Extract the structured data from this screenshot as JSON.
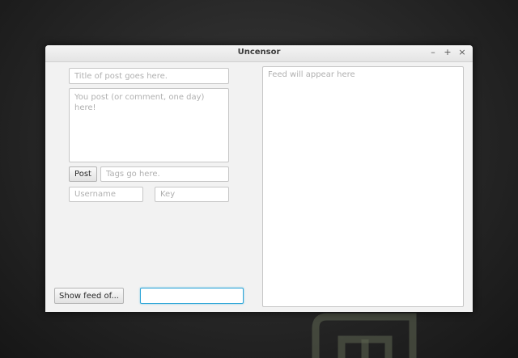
{
  "window": {
    "title": "Uncensor",
    "controls": {
      "minimize": "–",
      "maximize": "+",
      "close": "×"
    }
  },
  "form": {
    "title_placeholder": "Title of post goes here.",
    "title_value": "",
    "body_placeholder": "You post (or comment, one day) here!",
    "body_value": "",
    "post_label": "Post",
    "tags_placeholder": "Tags go here.",
    "tags_value": "",
    "username_placeholder": "Username",
    "username_value": "",
    "key_placeholder": "Key",
    "key_value": ""
  },
  "feed": {
    "show_label": "Show feed of...",
    "feed_name_value": "",
    "feed_placeholder": "Feed will appear here"
  },
  "colors": {
    "focus_border": "#2fa6d8",
    "window_bg": "#f2f2f2",
    "desktop_logo": "#8a9a6a"
  },
  "icons": {
    "desktop_logo": "mint-logo-icon"
  }
}
